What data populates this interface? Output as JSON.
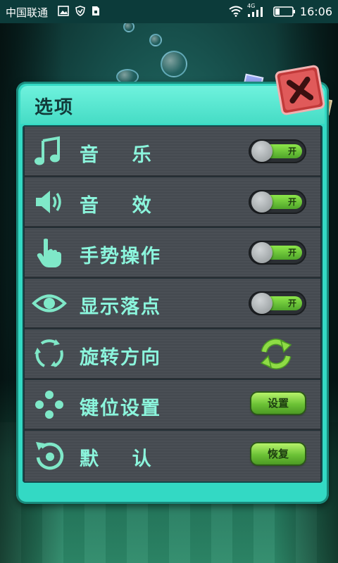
{
  "status_bar": {
    "carrier": "中国联通",
    "network": "4G",
    "time": "16:06"
  },
  "panel": {
    "title": "选项"
  },
  "settings": [
    {
      "label": "音    乐",
      "icon": "music-note-icon",
      "control": "toggle",
      "control_text": "开"
    },
    {
      "label": "音    效",
      "icon": "speaker-icon",
      "control": "toggle",
      "control_text": "开"
    },
    {
      "label": "手势操作",
      "icon": "hand-pointer-icon",
      "control": "toggle",
      "control_text": "开"
    },
    {
      "label": "显示落点",
      "icon": "eye-icon",
      "control": "toggle",
      "control_text": "开"
    },
    {
      "label": "旋转方向",
      "icon": "rotate-arrows-icon",
      "control": "rotate"
    },
    {
      "label": "键位设置",
      "icon": "dpad-icon",
      "control": "button",
      "control_text": "设置"
    },
    {
      "label": "默    认",
      "icon": "reset-icon",
      "control": "button",
      "control_text": "恢复"
    }
  ],
  "colors": {
    "panel": "#33d9c4",
    "label": "#8bf5dc",
    "toggle_on": "#6cc236",
    "close": "#e05a5a"
  }
}
